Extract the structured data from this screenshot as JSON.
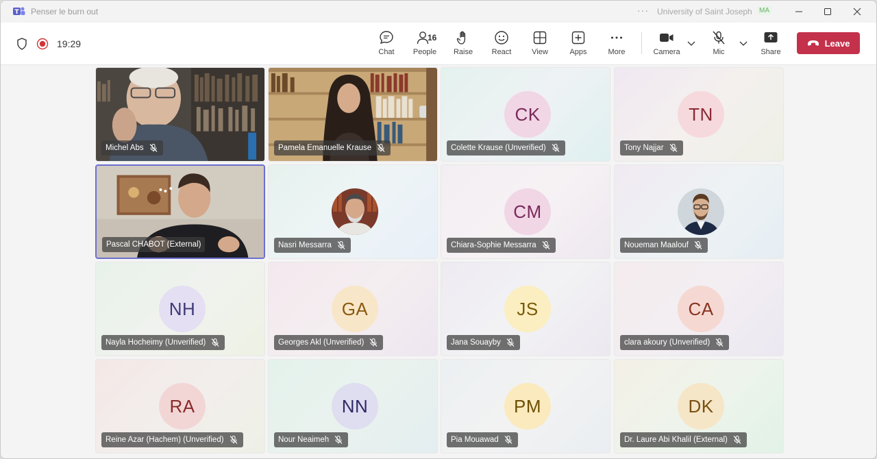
{
  "window": {
    "title": "Penser le burn out",
    "org_name": "University of Saint Joseph",
    "org_badge": "MA"
  },
  "toolbar": {
    "timer": "19:29",
    "people_count": "16",
    "items": {
      "chat": "Chat",
      "people": "People",
      "raise": "Raise",
      "react": "React",
      "view": "View",
      "apps": "Apps",
      "more": "More",
      "camera": "Camera",
      "mic": "Mic",
      "share": "Share"
    },
    "leave_label": "Leave"
  },
  "participants": [
    {
      "name": "Michel Abs",
      "type": "video",
      "muted": true
    },
    {
      "name": "Pamela Emanuelle Krause",
      "type": "video",
      "muted": true
    },
    {
      "name": "Colette Krause (Unverified)",
      "initials": "CK",
      "type": "initials",
      "muted": true,
      "avatar_bg": "#f1d6e6",
      "avatar_fg": "#7a2a5a"
    },
    {
      "name": "Tony Najjar",
      "initials": "TN",
      "type": "initials",
      "muted": true,
      "avatar_bg": "#f6d9dc",
      "avatar_fg": "#8a2a35"
    },
    {
      "name": "Pascal CHABOT (External)",
      "type": "video",
      "muted": false,
      "active": true
    },
    {
      "name": "Nasri Messarra",
      "type": "photo",
      "muted": true
    },
    {
      "name": "Chiara-Sophie Messarra",
      "initials": "CM",
      "type": "initials",
      "muted": true,
      "avatar_bg": "#f1d6e6",
      "avatar_fg": "#7a2a5a"
    },
    {
      "name": "Noueman Maalouf",
      "type": "photo",
      "muted": true
    },
    {
      "name": "Nayla Hocheimy (Unverified)",
      "initials": "NH",
      "type": "initials",
      "muted": true,
      "avatar_bg": "#e4dff2",
      "avatar_fg": "#3e3a78"
    },
    {
      "name": "Georges Akl (Unverified)",
      "initials": "GA",
      "type": "initials",
      "muted": true,
      "avatar_bg": "#f8e6c8",
      "avatar_fg": "#8a5a12"
    },
    {
      "name": "Jana Souayby",
      "initials": "JS",
      "type": "initials",
      "muted": true,
      "avatar_bg": "#fbeec0",
      "avatar_fg": "#7a5a08"
    },
    {
      "name": "clara akoury (Unverified)",
      "initials": "CA",
      "type": "initials",
      "muted": true,
      "avatar_bg": "#f6d8d2",
      "avatar_fg": "#8a3422"
    },
    {
      "name": "Reine Azar (Hachem) (Unverified)",
      "initials": "RA",
      "type": "initials",
      "muted": true,
      "avatar_bg": "#f2d6d6",
      "avatar_fg": "#8a2a2a"
    },
    {
      "name": "Nour Neaimeh",
      "initials": "NN",
      "type": "initials",
      "muted": true,
      "avatar_bg": "#dfddf0",
      "avatar_fg": "#2e2a66"
    },
    {
      "name": "Pia Mouawad",
      "initials": "PM",
      "type": "initials",
      "muted": true,
      "avatar_bg": "#fbeabd",
      "avatar_fg": "#6e4e06"
    },
    {
      "name": "Dr. Laure Abi Khalil (External)",
      "initials": "DK",
      "type": "initials",
      "muted": true,
      "avatar_bg": "#f6e6c8",
      "avatar_fg": "#7a5012"
    }
  ],
  "colors": {
    "leave": "#c4314b",
    "active_border": "#6b6fd0",
    "recording": "#d13438"
  }
}
